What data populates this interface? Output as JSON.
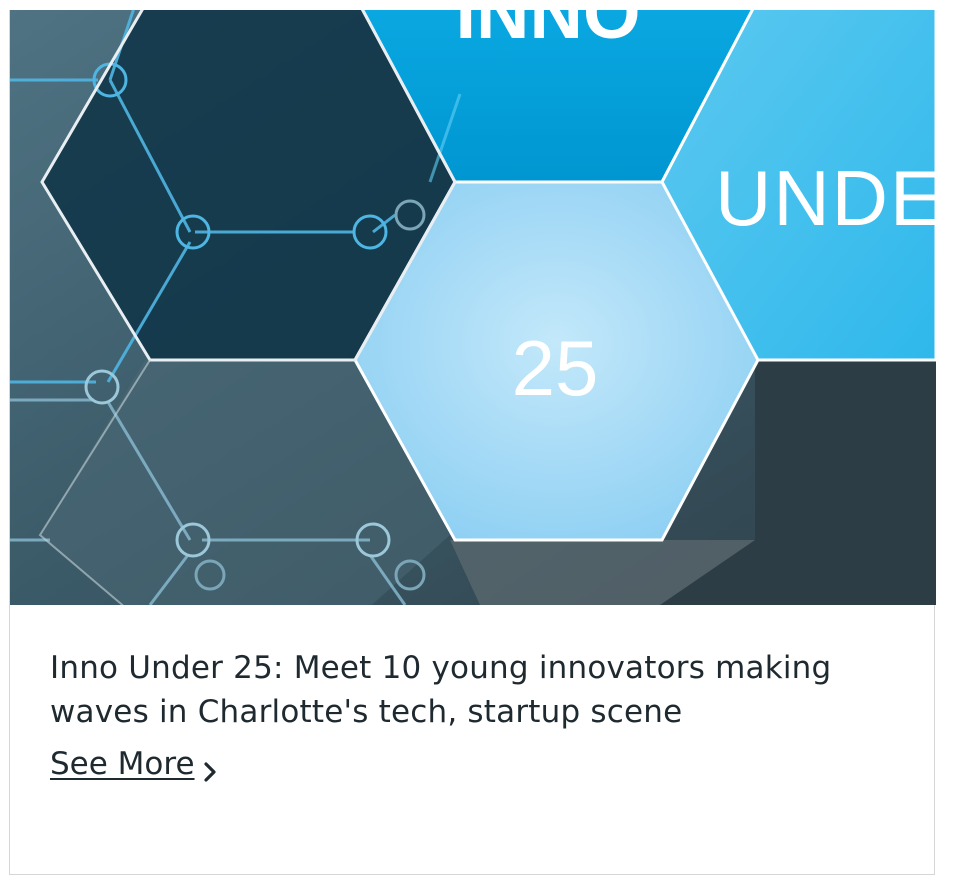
{
  "card": {
    "image": {
      "text_inno": "INNO",
      "text_under": "UNDER",
      "text_number": "25"
    },
    "headline": "Inno Under 25: Meet 10 young innovators making waves in Charlotte's tech, startup scene",
    "see_more_label": "See More",
    "icon": "chevron-right-icon",
    "colors": {
      "hex_top": "#00a3e0",
      "hex_center": "#a8dcf5",
      "hex_right": "#4bc3ef",
      "background_dark": "#37525e"
    }
  }
}
